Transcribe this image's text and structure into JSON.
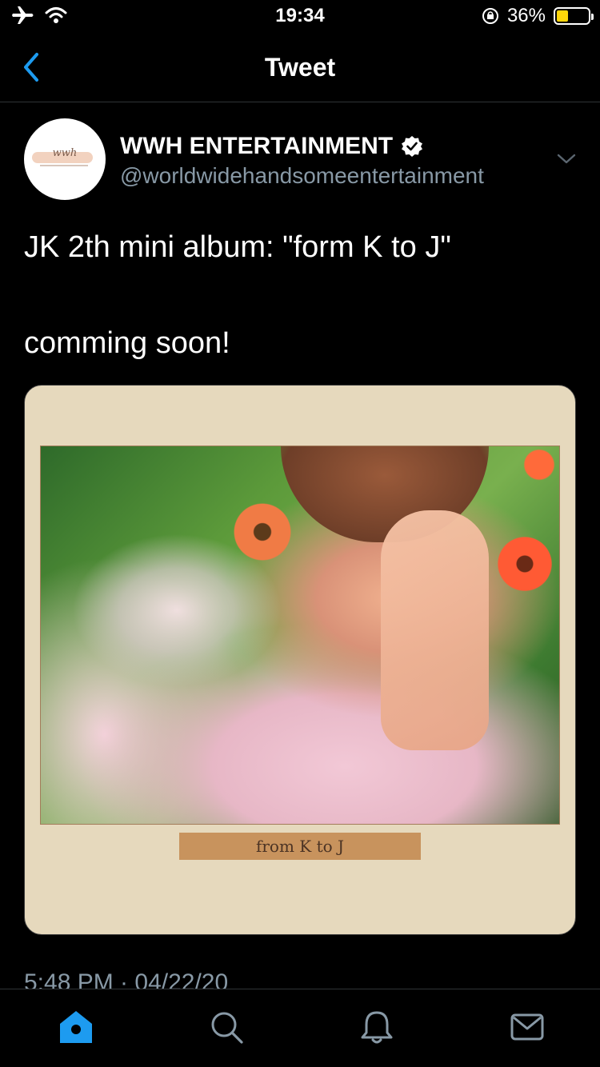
{
  "status_bar": {
    "time": "19:34",
    "battery_percent": "36%",
    "battery_level": 0.36,
    "battery_color": "#ffd60a",
    "icons": [
      "airplane-icon",
      "wifi-icon",
      "rotation-lock-icon",
      "battery-icon"
    ]
  },
  "nav": {
    "title": "Tweet",
    "back_icon": "chevron-left-icon",
    "accent_color": "#1d9bf0"
  },
  "tweet": {
    "author": {
      "display_name": "WWH ENTERTAINMENT",
      "handle": "@worldwidehandsomeentertainment",
      "verified": true,
      "avatar_text": "wwh"
    },
    "text_lines": [
      "JK 2th mini album: \"form K to J\"",
      "comming soon!"
    ],
    "media": {
      "caption": "from K to J",
      "card_color": "#e6d9bd",
      "caption_color": "#c8935d"
    },
    "timestamp": "5:48 PM · 04/22/20"
  },
  "tab_bar": {
    "tabs": [
      {
        "name": "home",
        "icon": "home-icon",
        "active": true
      },
      {
        "name": "search",
        "icon": "search-icon",
        "active": false
      },
      {
        "name": "notifications",
        "icon": "bell-icon",
        "active": false
      },
      {
        "name": "messages",
        "icon": "mail-icon",
        "active": false
      }
    ]
  }
}
